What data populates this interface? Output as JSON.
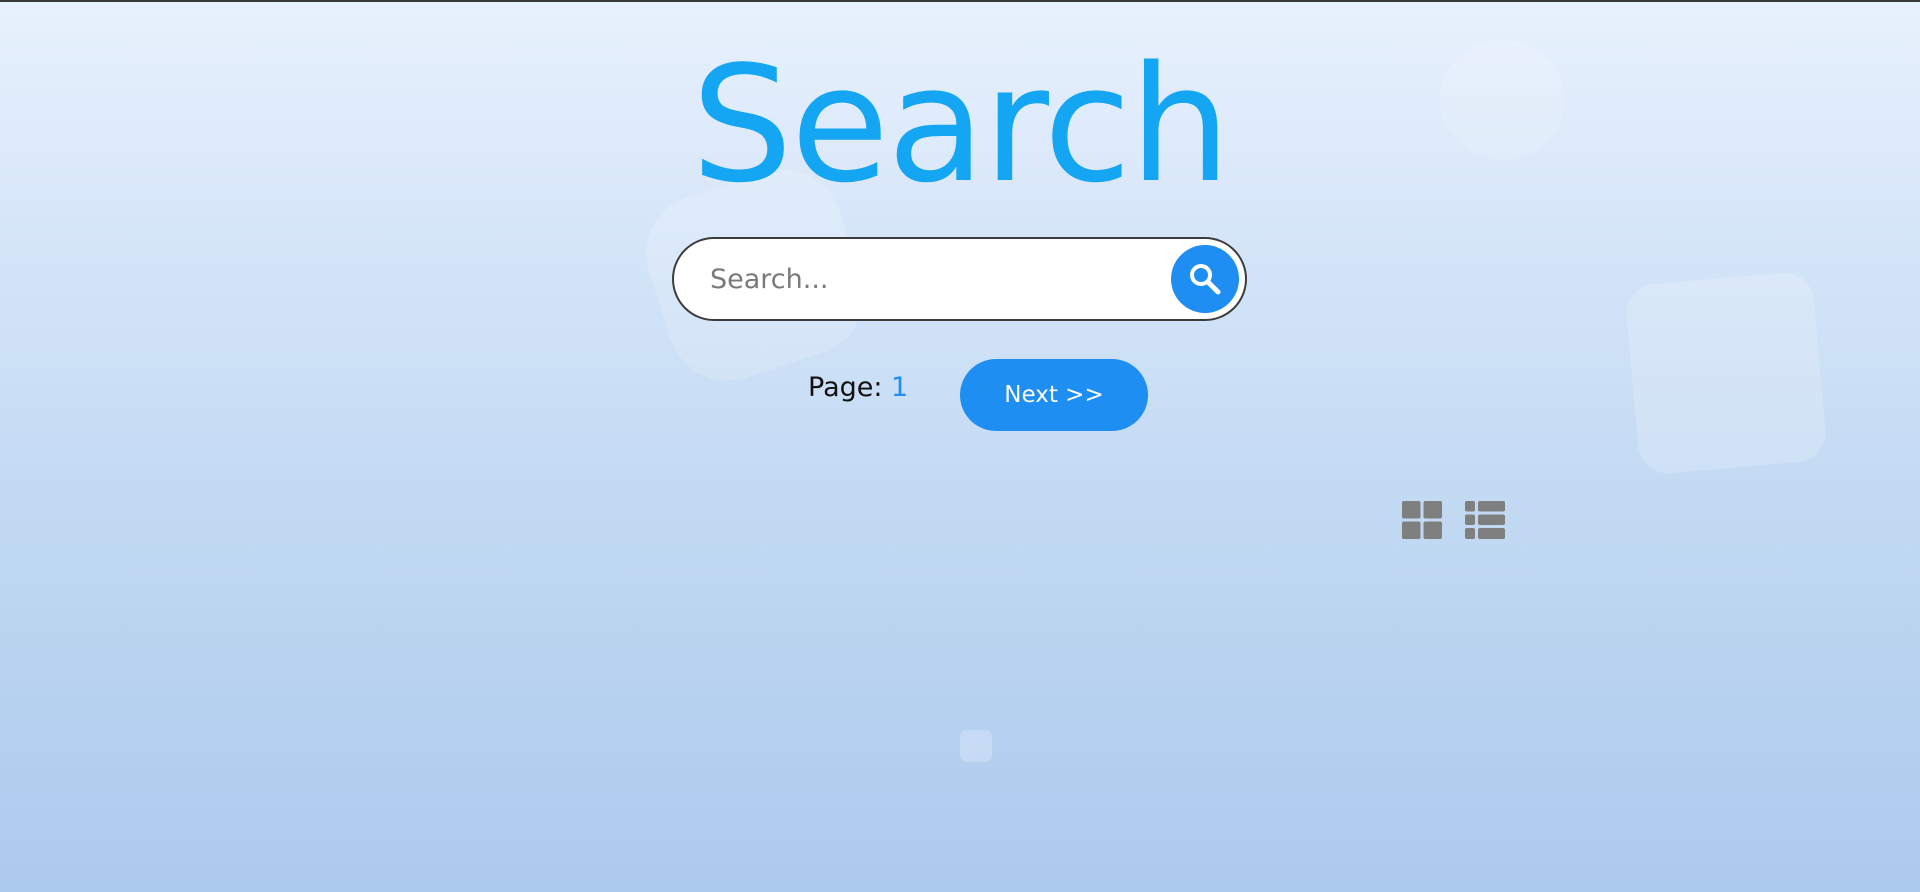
{
  "page": {
    "title": "Search"
  },
  "search": {
    "placeholder": "Search...",
    "value": "",
    "button_icon": "search-icon"
  },
  "pagination": {
    "label": "Page: ",
    "current_page": "1",
    "next_label": "Next >>"
  },
  "view_toggles": [
    {
      "icon": "grid-view-icon"
    },
    {
      "icon": "list-view-icon"
    }
  ],
  "colors": {
    "accent": "#1e8ef3",
    "title": "#14a6f2",
    "icon_gray": "#7f7f7f"
  }
}
